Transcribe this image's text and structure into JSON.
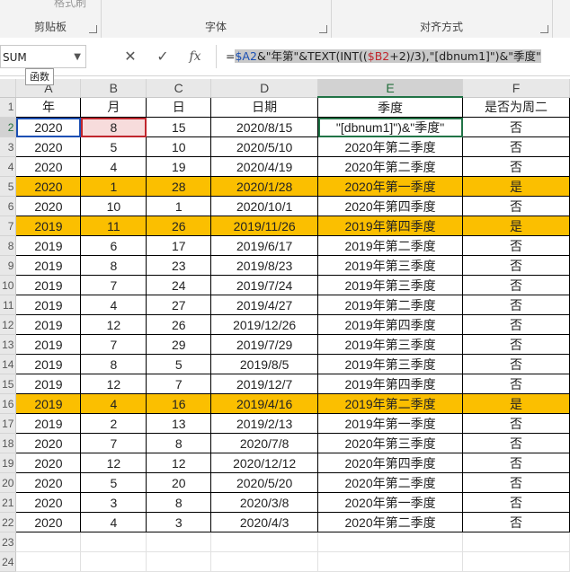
{
  "ribbon": {
    "groups": [
      {
        "label": "剪贴板",
        "ghost": "格式刷"
      },
      {
        "label": "字体",
        "ghost": ""
      },
      {
        "label": "对齐方式",
        "ghost": ""
      }
    ]
  },
  "formula_bar": {
    "name_box": "SUM",
    "cancel": "✕",
    "enter": "✓",
    "fx": "fx",
    "formula": {
      "p1": "=",
      "p2": "$A2",
      "p3": "&\"年第\"&TEXT(INT((",
      "p4": "$B2",
      "p5": "+2)/3),\"[dbnum1]\")&\"季度\""
    }
  },
  "tooltip": "函数",
  "columns": [
    "A",
    "B",
    "C",
    "D",
    "E",
    "F"
  ],
  "active_column": "E",
  "header_row": [
    "年",
    "月",
    "日",
    "日期",
    "季度",
    "是否为周二"
  ],
  "rows": [
    {
      "n": "2",
      "cells": [
        "2020",
        "8",
        "15",
        "2020/8/15",
        "\"[dbnum1]\")&\"季度\"",
        "否"
      ],
      "hl": false
    },
    {
      "n": "3",
      "cells": [
        "2020",
        "5",
        "10",
        "2020/5/10",
        "2020年第二季度",
        "否"
      ],
      "hl": false
    },
    {
      "n": "4",
      "cells": [
        "2020",
        "4",
        "19",
        "2020/4/19",
        "2020年第二季度",
        "否"
      ],
      "hl": false
    },
    {
      "n": "5",
      "cells": [
        "2020",
        "1",
        "28",
        "2020/1/28",
        "2020年第一季度",
        "是"
      ],
      "hl": true
    },
    {
      "n": "6",
      "cells": [
        "2020",
        "10",
        "1",
        "2020/10/1",
        "2020年第四季度",
        "否"
      ],
      "hl": false
    },
    {
      "n": "7",
      "cells": [
        "2019",
        "11",
        "26",
        "2019/11/26",
        "2019年第四季度",
        "是"
      ],
      "hl": true
    },
    {
      "n": "8",
      "cells": [
        "2019",
        "6",
        "17",
        "2019/6/17",
        "2019年第二季度",
        "否"
      ],
      "hl": false
    },
    {
      "n": "9",
      "cells": [
        "2019",
        "8",
        "23",
        "2019/8/23",
        "2019年第三季度",
        "否"
      ],
      "hl": false
    },
    {
      "n": "10",
      "cells": [
        "2019",
        "7",
        "24",
        "2019/7/24",
        "2019年第三季度",
        "否"
      ],
      "hl": false
    },
    {
      "n": "11",
      "cells": [
        "2019",
        "4",
        "27",
        "2019/4/27",
        "2019年第二季度",
        "否"
      ],
      "hl": false
    },
    {
      "n": "12",
      "cells": [
        "2019",
        "12",
        "26",
        "2019/12/26",
        "2019年第四季度",
        "否"
      ],
      "hl": false
    },
    {
      "n": "13",
      "cells": [
        "2019",
        "7",
        "29",
        "2019/7/29",
        "2019年第三季度",
        "否"
      ],
      "hl": false
    },
    {
      "n": "14",
      "cells": [
        "2019",
        "8",
        "5",
        "2019/8/5",
        "2019年第三季度",
        "否"
      ],
      "hl": false
    },
    {
      "n": "15",
      "cells": [
        "2019",
        "12",
        "7",
        "2019/12/7",
        "2019年第四季度",
        "否"
      ],
      "hl": false
    },
    {
      "n": "16",
      "cells": [
        "2019",
        "4",
        "16",
        "2019/4/16",
        "2019年第二季度",
        "是"
      ],
      "hl": true
    },
    {
      "n": "17",
      "cells": [
        "2019",
        "2",
        "13",
        "2019/2/13",
        "2019年第一季度",
        "否"
      ],
      "hl": false
    },
    {
      "n": "18",
      "cells": [
        "2020",
        "7",
        "8",
        "2020/7/8",
        "2020年第三季度",
        "否"
      ],
      "hl": false
    },
    {
      "n": "19",
      "cells": [
        "2020",
        "12",
        "12",
        "2020/12/12",
        "2020年第四季度",
        "否"
      ],
      "hl": false
    },
    {
      "n": "20",
      "cells": [
        "2020",
        "5",
        "20",
        "2020/5/20",
        "2020年第二季度",
        "否"
      ],
      "hl": false
    },
    {
      "n": "21",
      "cells": [
        "2020",
        "3",
        "8",
        "2020/3/8",
        "2020年第一季度",
        "否"
      ],
      "hl": false
    },
    {
      "n": "22",
      "cells": [
        "2020",
        "4",
        "3",
        "2020/4/3",
        "2020年第二季度",
        "否"
      ],
      "hl": false
    }
  ],
  "empty_rows": [
    "23",
    "24"
  ]
}
